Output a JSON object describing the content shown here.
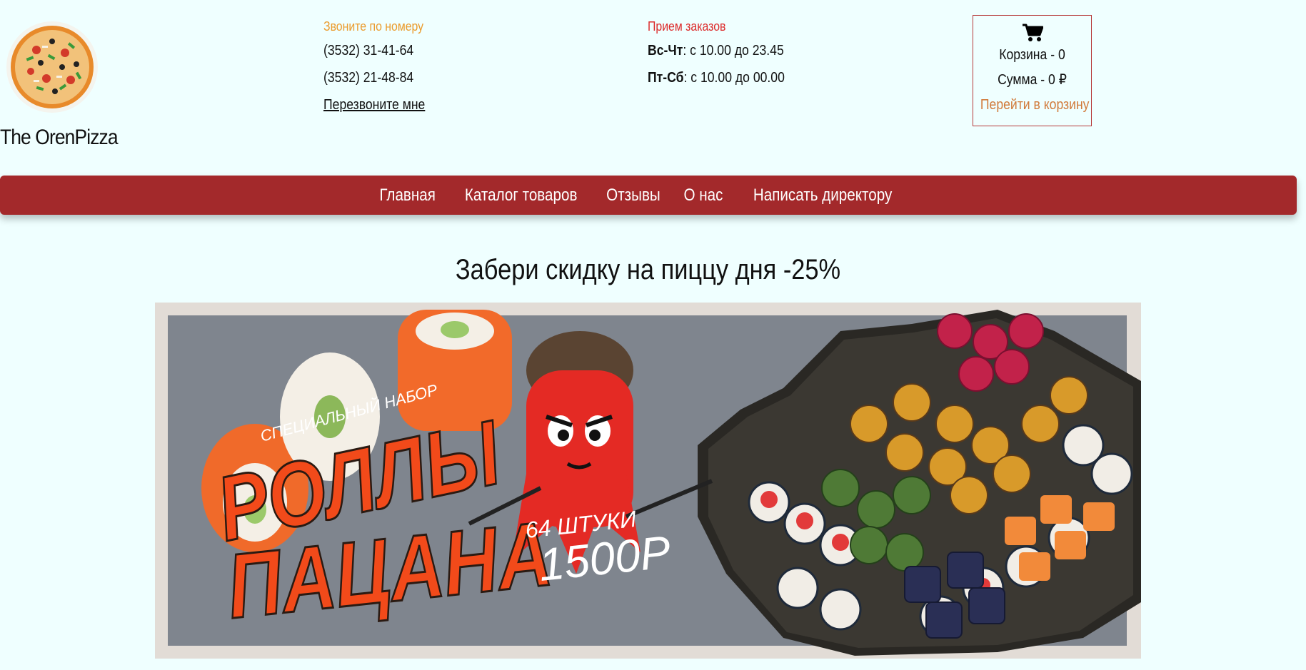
{
  "brand": {
    "name": "The OrenPizza",
    "logo_icon": "pizza-icon"
  },
  "contacts": {
    "label": "Звоните по номеру",
    "phones": [
      "(3532) 31-41-64",
      "(3532) 21-48-84"
    ],
    "callback_label": "Перезвоните мне"
  },
  "hours": {
    "label": "Прием заказов",
    "rows": [
      {
        "days": "Вс-Чт",
        "time": ": с 10.00 до 23.45"
      },
      {
        "days": "Пт-Сб",
        "time": ": с 10.00 до 00.00"
      }
    ]
  },
  "cart": {
    "icon": "shopping-cart-icon",
    "count_label": "Корзина - 0",
    "sum_label": "Сумма - 0 ₽",
    "link_label": "Перейти в корзину"
  },
  "nav": {
    "items": [
      "Главная",
      "Каталог товаров",
      "Отзывы",
      "О нас",
      "Написать директору"
    ]
  },
  "promo": {
    "title": "Забери скидку на пиццу дня -25%",
    "banner": {
      "subtitle": "СПЕЦИАЛЬНЫЙ НАБОР",
      "line1": "РОЛЛЫ",
      "line2": "ПАЦАНА",
      "count": "64 ШТУКИ",
      "price": "1500Р"
    }
  },
  "colors": {
    "background": "#efffff",
    "nav_bg": "#a3292b",
    "accent_orange": "#eb9b2c",
    "accent_red": "#dc2a2a",
    "cart_border": "#b63a3a",
    "cart_link": "#d17a3a"
  }
}
